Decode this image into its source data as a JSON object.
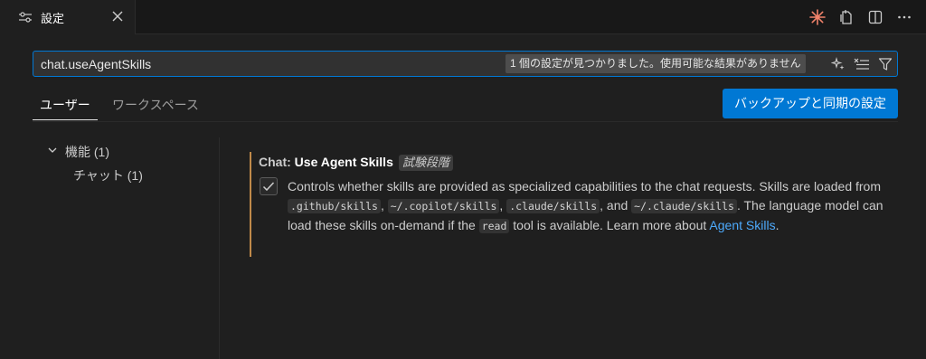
{
  "tab": {
    "title": "設定",
    "icon": "settings-sliders-icon",
    "close_icon": "close-icon"
  },
  "tab_actions": [
    "copilot-sparkle-icon",
    "open-settings-json-icon",
    "split-editor-icon",
    "more-actions-icon"
  ],
  "search": {
    "value": "chat.useAgentSkills",
    "result_count": "1 個の設定が見つかりました。使用可能な結果がありません",
    "tools": [
      "ai-search-icon",
      "clear-filter-icon",
      "filter-icon"
    ]
  },
  "scopes": {
    "user": "ユーザー",
    "workspace": "ワークスペース"
  },
  "sync_button": "バックアップと同期の設定",
  "tree": {
    "group": "機能 (1)",
    "child": "チャット (1)"
  },
  "setting": {
    "category": "Chat: ",
    "name": "Use Agent Skills",
    "tag": "試験段階",
    "checked": true,
    "desc": {
      "p1": "Controls whether skills are provided as specialized capabilities to the chat requests. Skills are loaded from ",
      "code1": ".github/skills",
      "sep1": ", ",
      "code2": "~/.copilot/skills",
      "sep2": ", ",
      "code3": ".claude/skills",
      "sep3": ", and ",
      "code4": "~/.claude/skills",
      "p2": ". The language model can load these skills on-demand if the ",
      "code5": "read",
      "p3": " tool is available. Learn more about ",
      "link": "Agent Skills",
      "p4": "."
    }
  },
  "colors": {
    "accent": "#0078d4",
    "link": "#4daafc",
    "modified_bar": "#c08a4a",
    "sparkle": "#f0826a"
  }
}
